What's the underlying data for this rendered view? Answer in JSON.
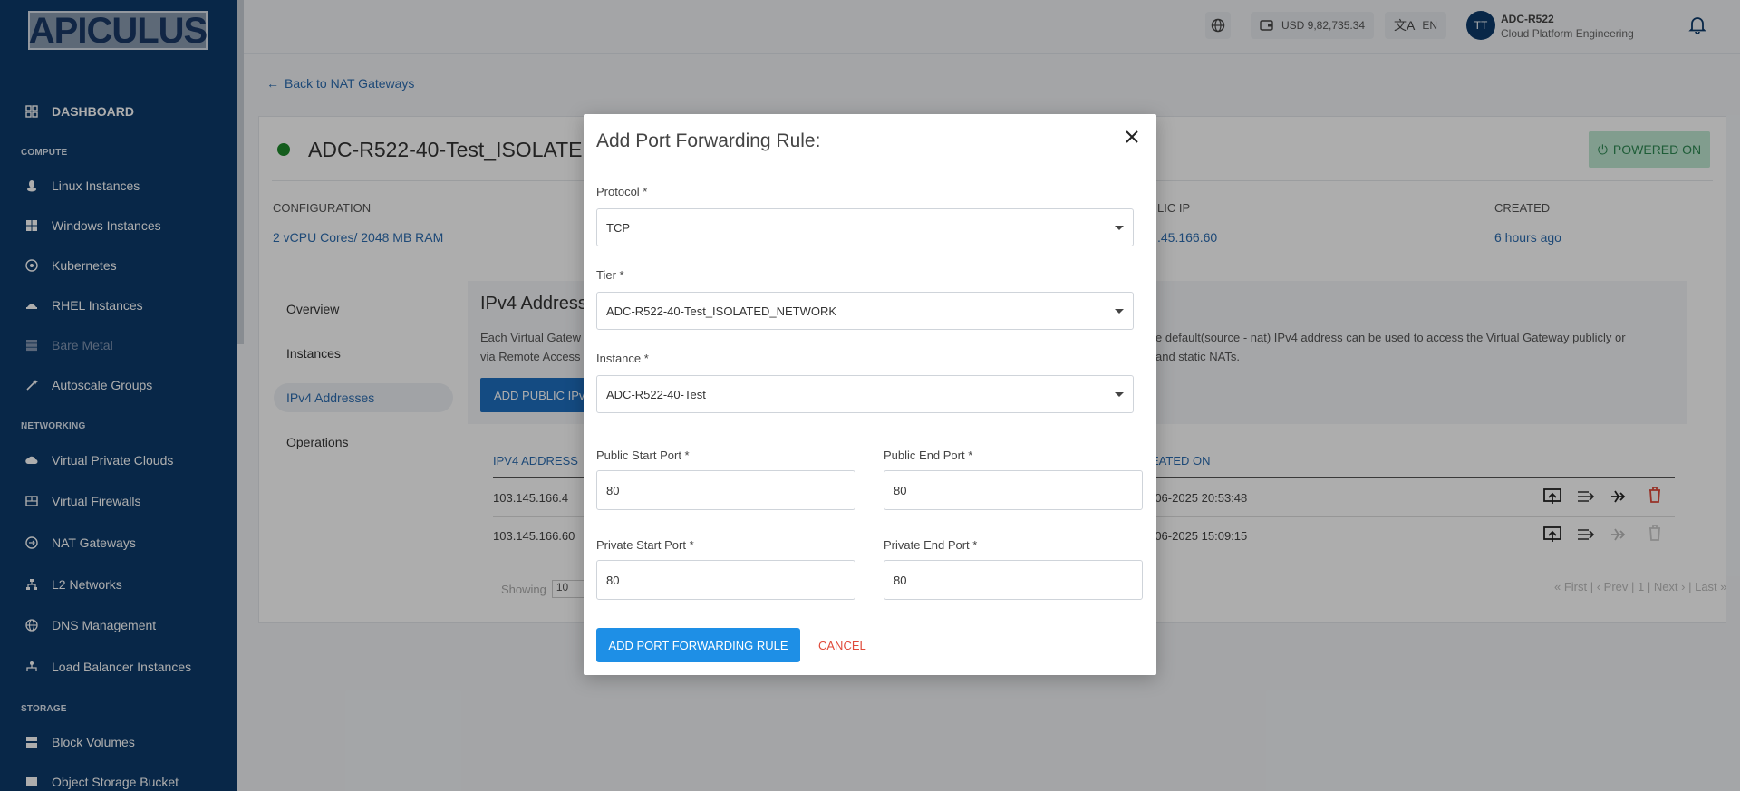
{
  "sidebar": {
    "logo": "APICULUS",
    "dashboard": "DASHBOARD",
    "sections": {
      "compute": "COMPUTE",
      "networking": "NETWORKING",
      "storage": "STORAGE"
    },
    "items": {
      "linux": "Linux Instances",
      "windows": "Windows Instances",
      "kubernetes": "Kubernetes",
      "rhel": "RHEL Instances",
      "bare_metal": "Bare Metal",
      "autoscale": "Autoscale Groups",
      "vpc": "Virtual Private Clouds",
      "firewalls": "Virtual Firewalls",
      "nat": "NAT Gateways",
      "l2": "L2 Networks",
      "dns": "DNS Management",
      "lb": "Load Balancer Instances",
      "block": "Block Volumes",
      "object": "Object Storage Bucket"
    }
  },
  "header": {
    "balance": "USD 9,82,735.34",
    "language": "EN",
    "avatar_initials": "TT",
    "user_name": "ADC-R522",
    "user_org": "Cloud Platform Engineering"
  },
  "page": {
    "back_link": "Back to NAT Gateways",
    "instance_title": "ADC-R522-40-Test_ISOLATED",
    "power_status": "POWERED ON",
    "config_label": "CONFIGURATION",
    "config_value": "2 vCPU Cores/ 2048 MB RAM",
    "public_ip_label": "LIC IP",
    "public_ip_value": ".45.166.60",
    "created_label": "CREATED",
    "created_value": "6 hours ago",
    "tabs": {
      "overview": "Overview",
      "instances": "Instances",
      "ipv4": "IPv4 Addresses",
      "operations": "Operations"
    },
    "ipv4_title": "IPv4 Address",
    "ipv4_desc_line1_left": "Each Virtual Gatew",
    "ipv4_desc_line1_right": "e default(source - nat) IPv4 address can be used to access the Virtual Gateway publicly or",
    "ipv4_desc_line2_left": "via Remote Access",
    "ipv4_desc_line2_right": "and static NATs.",
    "add_public_btn": "ADD PUBLIC IPv",
    "table": {
      "col_ip": "IPV4 ADDRESS",
      "col_created": "EATED ON",
      "rows": [
        {
          "ip": "103.145.166.4",
          "created": "-06-2025 20:53:48"
        },
        {
          "ip": "103.145.166.60",
          "created": "-06-2025 15:09:15"
        }
      ]
    },
    "showing_label": "Showing",
    "page_size": "10",
    "pager": "« First | ‹ Prev | 1 | Next › | Last »"
  },
  "modal": {
    "title": "Add Port Forwarding Rule:",
    "protocol_label": "Protocol *",
    "protocol_value": "TCP",
    "tier_label": "Tier *",
    "tier_value": "ADC-R522-40-Test_ISOLATED_NETWORK",
    "instance_label": "Instance *",
    "instance_value": "ADC-R522-40-Test",
    "public_start_label": "Public Start Port *",
    "public_start_value": "80",
    "public_end_label": "Public End Port *",
    "public_end_value": "80",
    "private_start_label": "Private Start Port *",
    "private_start_value": "80",
    "private_end_label": "Private End Port *",
    "private_end_value": "80",
    "submit_label": "ADD PORT FORWARDING RULE",
    "cancel_label": "CANCEL"
  },
  "colors": {
    "sidebar_bg": "#0c3a6b",
    "accent_blue": "#1e8fe6",
    "link_blue": "#2c6cb0",
    "status_green": "#1e8a2b",
    "cancel_red": "#e04a3a",
    "powered_bg": "#bfe7d2"
  }
}
